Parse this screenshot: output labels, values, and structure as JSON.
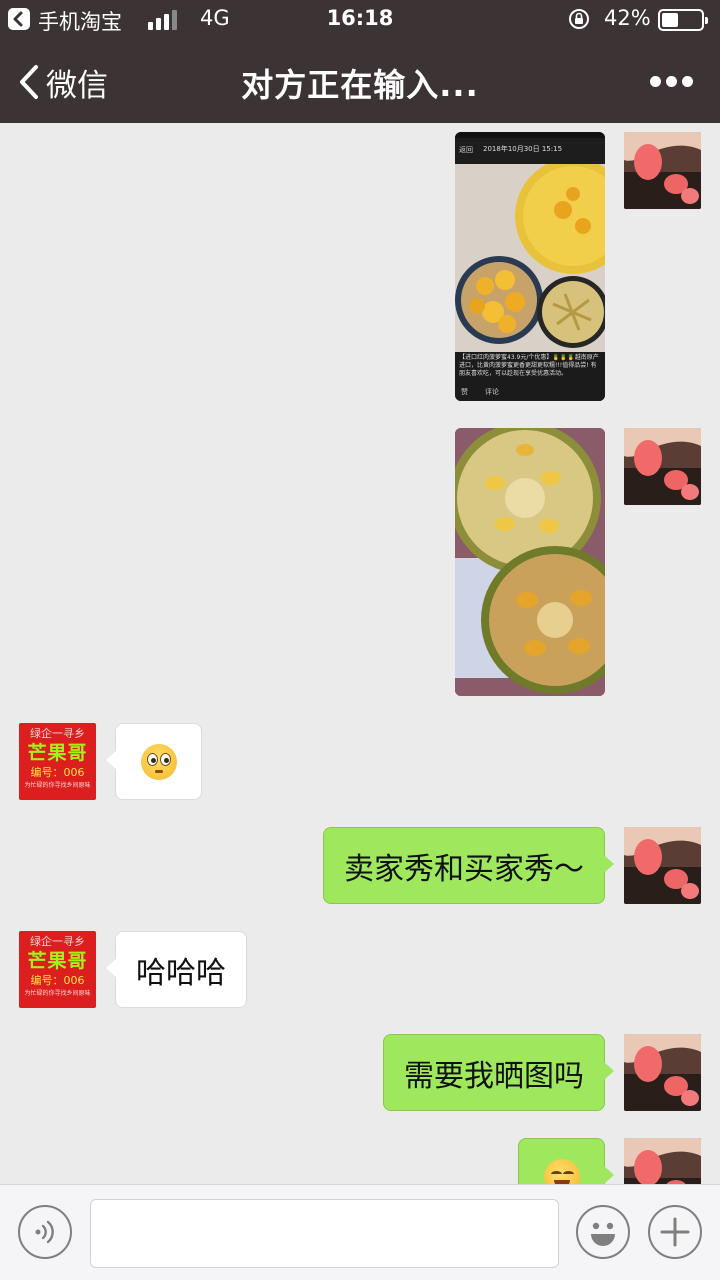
{
  "status_bar": {
    "app_name": "手机淘宝",
    "network": "4G",
    "time": "16:18",
    "battery_percent_label": "42%",
    "battery_level": 0.42
  },
  "nav": {
    "back_label": "微信",
    "title": "对方正在输入..."
  },
  "contact_avatar": {
    "line1": "绿企一寻乡",
    "line2": "芒果哥",
    "line3": "编号：006",
    "line4": "为忙碌的你寻找乡间原味"
  },
  "screenshot_photo": {
    "header_date": "2018年10月30日 15:15",
    "back_label": "返回",
    "caption": "【进口红肉菠萝蜜43.9元/个优惠】🍍🍍🍍越南原产进口，比黄肉菠萝蜜更香更甜更软糯!!!值得品尝! 有朋友喜欢吃，可以趁现在享受优惠活动。",
    "like_label": "赞",
    "comment_label": "评论"
  },
  "messages": [
    {
      "sender": "me",
      "type": "image",
      "content": "screenshot"
    },
    {
      "sender": "me",
      "type": "image",
      "content": "jackfruit-halves"
    },
    {
      "sender": "them",
      "type": "emoji",
      "content": "flushed-face"
    },
    {
      "sender": "me",
      "type": "text",
      "text": "卖家秀和买家秀～"
    },
    {
      "sender": "them",
      "type": "text",
      "text": "哈哈哈"
    },
    {
      "sender": "me",
      "type": "text",
      "text": "需要我晒图吗"
    },
    {
      "sender": "me",
      "type": "emoji",
      "content": "smiling-face"
    }
  ],
  "input_bar": {
    "voice_icon": "voice-icon",
    "emoji_icon": "smiley-icon",
    "add_icon": "plus-icon"
  },
  "colors": {
    "header_bg": "#3c3434",
    "chat_bg": "#ebebeb",
    "my_bubble": "#9fe85e",
    "their_bubble": "#ffffff"
  }
}
